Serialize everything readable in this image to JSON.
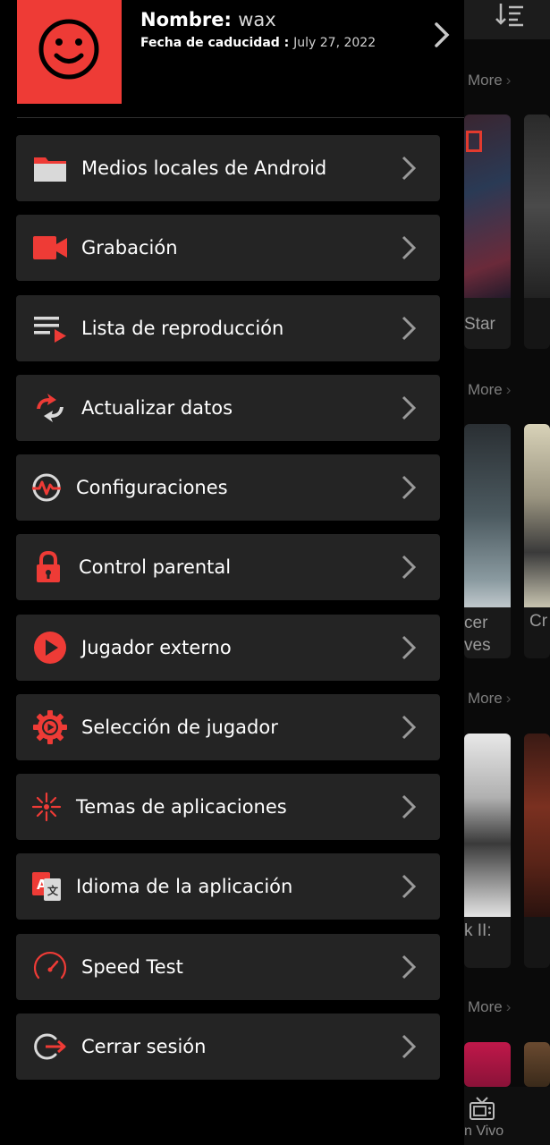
{
  "header": {
    "name_label": "Nombre:",
    "name_value": "wax",
    "expiry_label": "Fecha de caducidad :",
    "expiry_value": "July 27, 2022"
  },
  "menu": [
    {
      "label": "Medios locales de Android",
      "icon": "folder-icon"
    },
    {
      "label": "Grabación",
      "icon": "video-camera-icon"
    },
    {
      "label": "Lista de reproducción",
      "icon": "playlist-icon"
    },
    {
      "label": "Actualizar datos",
      "icon": "refresh-icon"
    },
    {
      "label": "Configuraciones",
      "icon": "settings-pulse-icon"
    },
    {
      "label": "Control parental",
      "icon": "lock-icon"
    },
    {
      "label": "Jugador externo",
      "icon": "play-circle-icon"
    },
    {
      "label": "Selección de jugador",
      "icon": "gear-play-icon"
    },
    {
      "label": "Temas de aplicaciones",
      "icon": "sparkle-icon"
    },
    {
      "label": "Idioma de la aplicación",
      "icon": "translate-icon"
    },
    {
      "label": "Speed Test",
      "icon": "speedometer-icon"
    },
    {
      "label": "Cerrar sesión",
      "icon": "logout-icon"
    }
  ],
  "background": {
    "more_label": "More",
    "poster_titles": [
      "Star",
      "cer",
      "ves",
      "Cr",
      "k II:"
    ],
    "nav_label": "n Vivo"
  },
  "colors": {
    "accent": "#ee3b36",
    "item_bg": "#242424",
    "drawer_bg": "#000000"
  }
}
